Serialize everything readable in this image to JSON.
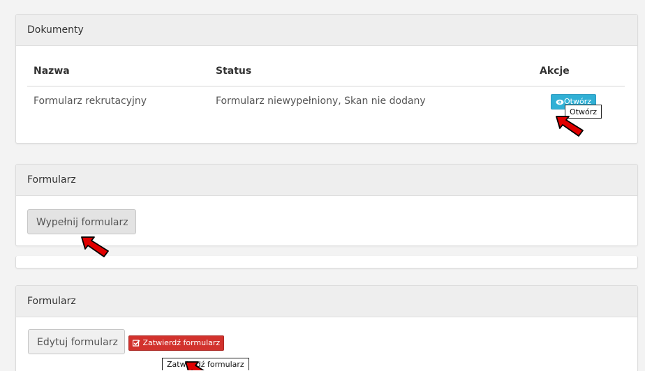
{
  "documents": {
    "title": "Dokumenty",
    "columns": [
      "Nazwa",
      "Status",
      "Akcje"
    ],
    "rows": [
      {
        "name": "Formularz rekrutacyjny",
        "status": "Formularz niewypełniony, Skan nie dodany",
        "action_label": "Otwórz"
      }
    ],
    "tooltip": "Otwórz"
  },
  "form_panel_1": {
    "title": "Formularz",
    "fill_button_label": "Wypełnij formularz"
  },
  "form_panel_2": {
    "title": "Formularz",
    "edit_button_label": "Edytuj formularz",
    "confirm_button_label": "Zatwierdź formularz",
    "tooltip": "Zatwierdź formularz"
  },
  "icons": {
    "open": "eye-icon",
    "confirm": "checkbox-edit-icon",
    "pointer": "red-arrow-icon"
  },
  "colors": {
    "info_button": "#31b0d5",
    "danger_button": "#d2322d",
    "arrow": "#e00000"
  }
}
